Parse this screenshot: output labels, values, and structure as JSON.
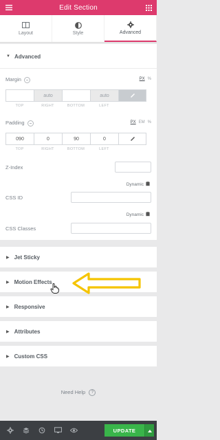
{
  "header": {
    "title": "Edit Section",
    "menu_icon": "hamburger-icon",
    "grid_icon": "grid-icon"
  },
  "tabs": [
    {
      "label": "Layout",
      "icon": "columns-icon"
    },
    {
      "label": "Style",
      "icon": "half-circle-icon"
    },
    {
      "label": "Advanced",
      "icon": "gear-icon",
      "active": true
    }
  ],
  "advanced": {
    "title": "Advanced",
    "margin": {
      "label": "Margin",
      "unit": "PX",
      "units_extra": "%",
      "values": [
        "",
        "auto",
        "",
        "auto"
      ],
      "sublabels": [
        "TOP",
        "RIGHT",
        "BOTTOM",
        "LEFT"
      ]
    },
    "padding": {
      "label": "Padding",
      "units": [
        "PX",
        "EM",
        "%"
      ],
      "values": [
        "090",
        "0",
        "90",
        "0"
      ],
      "sublabels": [
        "TOP",
        "RIGHT",
        "BOTTOM",
        "LEFT"
      ]
    },
    "z_index": {
      "label": "Z-Index",
      "value": ""
    },
    "dynamic_label": "Dynamic",
    "css_id": {
      "label": "CSS ID",
      "value": ""
    },
    "css_classes": {
      "label": "CSS Classes",
      "value": ""
    }
  },
  "sections": [
    "Jet Sticky",
    "Motion Effects",
    "Responsive",
    "Attributes",
    "Custom CSS"
  ],
  "help": {
    "label": "Need Help"
  },
  "footer": {
    "update_label": "UPDATE"
  },
  "colors": {
    "brand": "#dd3a6d",
    "update": "#39b54a",
    "footer": "#3c3f43",
    "arrow": "#f5c400"
  }
}
